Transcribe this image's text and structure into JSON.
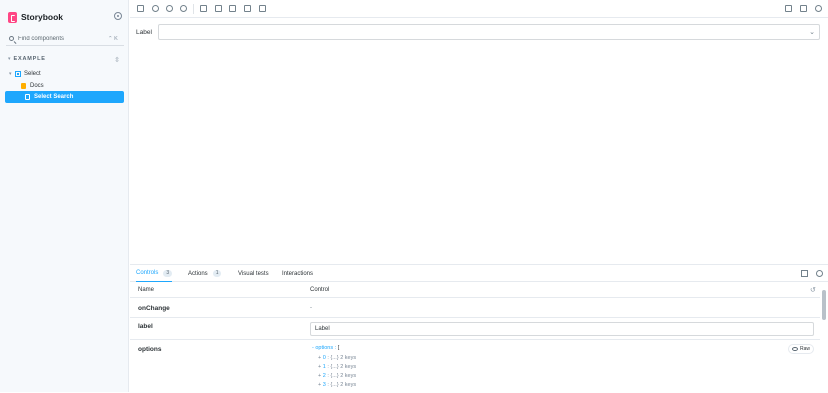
{
  "app": {
    "name": "Storybook"
  },
  "sidebar": {
    "search_placeholder": "Find components",
    "search_shortcut": "⌃ K",
    "section": "EXAMPLE",
    "tree": [
      {
        "label": "Select"
      },
      {
        "label": "Docs"
      },
      {
        "label": "Select Search"
      }
    ]
  },
  "preview": {
    "field_label": "Label",
    "select_value": ""
  },
  "panel": {
    "tabs": [
      {
        "label": "Controls",
        "badge": "3"
      },
      {
        "label": "Actions",
        "badge": "1"
      },
      {
        "label": "Visual tests"
      },
      {
        "label": "Interactions"
      }
    ],
    "columns": {
      "name": "Name",
      "control": "Control"
    },
    "rows": [
      {
        "name": "onChange",
        "control": "-"
      },
      {
        "name": "label",
        "value": "Label"
      },
      {
        "name": "options",
        "object_key": "options",
        "object_open": "[",
        "entries": [
          {
            "index": "0",
            "summary": "{...} 2 keys"
          },
          {
            "index": "1",
            "summary": "{...} 2 keys"
          },
          {
            "index": "2",
            "summary": "{...} 2 keys"
          },
          {
            "index": "3",
            "summary": "{...} 2 keys"
          }
        ],
        "raw_label": "Raw"
      }
    ]
  },
  "colors": {
    "accent": "#1ea7fd",
    "brand": "#ff4785",
    "sidebar_bg": "#f6f9fc"
  }
}
